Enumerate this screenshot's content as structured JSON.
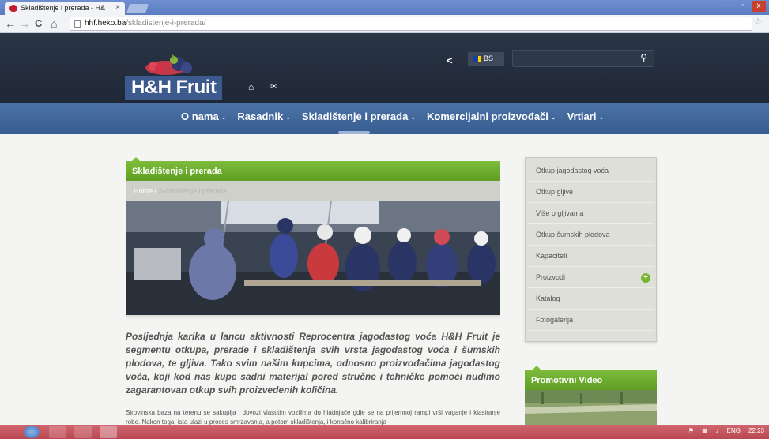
{
  "browser": {
    "tab_title": "Skladištenje i prerada - H&",
    "tab_close": "×",
    "url_host": "hhf.heko.ba",
    "url_path": "/skladistenje-i-prerada/",
    "back": "←",
    "forward": "→",
    "reload": "C",
    "home": "⌂",
    "star": "☆",
    "window_buttons": [
      "–",
      "▫",
      "x"
    ]
  },
  "header": {
    "logo_text": "H&H Fruit",
    "home_icon": "home-icon",
    "mail_icon": "mail-icon",
    "back_chevron": "<",
    "language": "BS",
    "search_placeholder": "",
    "search_icon": "search-icon"
  },
  "nav": {
    "items": [
      "O nama",
      "Rasadnik",
      "Skladištenje i prerada",
      "Komercijalni proizvođači",
      "Vrtlari"
    ]
  },
  "article": {
    "heading": "Skladištenje i prerada",
    "breadcrumb_home": "Home",
    "breadcrumb_sep": " / ",
    "breadcrumb_current": "Skladištenje i prerada",
    "lead": "Posljednja karika u lancu aktivnosti Reprocentra jagodastog voća H&H Fruit je segmentu otkupa, prerade i skladištenja svih vrsta jagodastog voća i šumskih plodova, te gljiva. Tako svim našim kupcima, odnosno proizvođačima jagodastog voća, koji kod nas kupe sadni materijal pored stručne i tehničke pomoći nudimo zagarantovan otkup svih proizvedenih količina.",
    "body": "Sirovinska baza na terenu se sakuplja i dovozi vlastitim vozilima do hladnjače gdje se na prijemnoj rampi vrši vaganje i klasiranje robe. Nakon toga, ista ulazi u proces smrzavanja, a potom skladištenja, i konačno kalibriranja"
  },
  "sidebar": {
    "items": [
      "Otkup jagodastog voća",
      "Otkup gljive",
      "Više o gljivama",
      "Otkup šumskih plodova",
      "Kapaciteti",
      "Proizvodi",
      "Katalog",
      "Fotogalerija"
    ],
    "expand_symbol": "+",
    "promo_title": "Promotivni Video"
  },
  "taskbar": {
    "language": "ENG",
    "clock": "22:23"
  },
  "colors": {
    "header_dark": "#232d3c",
    "nav_blue": "#4268a0",
    "accent_green": "#6aab2c",
    "logo_blue": "#3c5a8e",
    "taskbar_red": "#c4555d"
  }
}
